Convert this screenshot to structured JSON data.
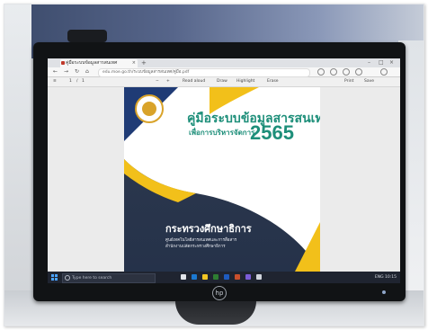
{
  "browser": {
    "tab_title": "คู่มือระบบข้อมูลสารสนเทศ",
    "tab_close": "×",
    "new_tab": "+",
    "window_controls": [
      "–",
      "□",
      "×"
    ],
    "nav": {
      "back": "←",
      "forward": "→",
      "reload": "↻",
      "home": "⌂"
    },
    "url": "edu.moe.go.th/ระบบข้อมูลสารสนเทศ/คู่มือ.pdf",
    "pdf_toolbar": [
      "≡",
      "1",
      "/",
      "1",
      "−",
      "+",
      "Read aloud",
      "Draw",
      "Highlight",
      "Erase",
      "Print",
      "Save"
    ]
  },
  "document": {
    "title": "คู่มือระบบข้อมูลสารสนเทศ",
    "subtitle": "เพื่อการบริหารจัดการ",
    "year": "2565",
    "ministry": "กระทรวงศึกษาธิการ",
    "unit_line1": "ศูนย์เทคโนโลยีสารสนเทศและการสื่อสาร",
    "unit_line2": "สำนักงานปลัดกระทรวงศึกษาธิการ"
  },
  "taskbar": {
    "search_placeholder": "Type here to search",
    "tray_text": "ENG  10:15"
  },
  "monitor": {
    "logo_text": "hp"
  },
  "colors": {
    "accent_teal": "#1e8f7a",
    "accent_yellow": "#f2c01a",
    "cover_navy": "#2f3a4e"
  }
}
